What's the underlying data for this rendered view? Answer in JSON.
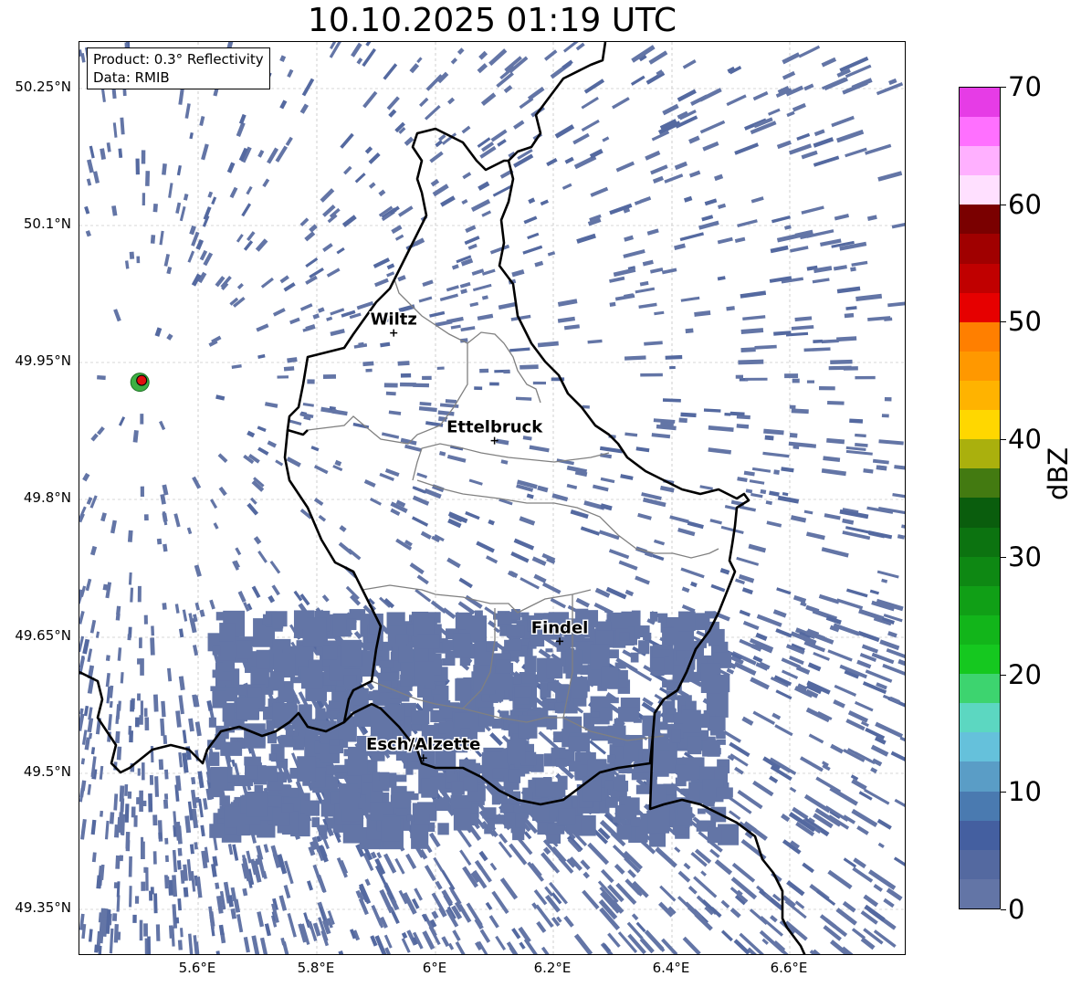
{
  "title": "10.10.2025 01:19 UTC",
  "product_box": {
    "product": "Product: 0.3° Reflectivity",
    "data": "Data: RMIB"
  },
  "lat_labels": [
    "50.25°N",
    "50.1°N",
    "49.95°N",
    "49.8°N",
    "49.65°N",
    "49.5°N",
    "49.35°N"
  ],
  "lon_labels": [
    "5.6°E",
    "5.8°E",
    "6°E",
    "6.2°E",
    "6.4°E",
    "6.6°E"
  ],
  "cities": [
    {
      "name": "Wiltz",
      "lon": 5.93,
      "lat": 49.966
    },
    {
      "name": "Ettelbruck",
      "lon": 6.1,
      "lat": 49.848
    },
    {
      "name": "Findel",
      "lon": 6.21,
      "lat": 49.628
    },
    {
      "name": "Esch/Alzette",
      "lon": 5.98,
      "lat": 49.5
    }
  ],
  "radar_site": {
    "lon": 5.505,
    "lat": 49.914
  },
  "colorbar": {
    "unit": "dBZ",
    "ticks": [
      "0",
      "10",
      "20",
      "30",
      "40",
      "50",
      "60",
      "70"
    ],
    "colors": [
      "#6375a6",
      "#5469a0",
      "#445fa0",
      "#4a7ab0",
      "#5a9dc6",
      "#65c1db",
      "#5cd7c1",
      "#3dd46f",
      "#15c81f",
      "#12b51a",
      "#109f16",
      "#0e8813",
      "#0c7310",
      "#0a5d0d",
      "#437a11",
      "#aab00d",
      "#ffd700",
      "#ffb300",
      "#ff9800",
      "#ff7f00",
      "#e60000",
      "#c00000",
      "#a00000",
      "#7a0000",
      "#ffe0ff",
      "#ffb0ff",
      "#ff70ff",
      "#e63ce6"
    ]
  },
  "map_extent": {
    "lon_min": 5.4,
    "lon_max": 6.795,
    "lat_min": 49.283,
    "lat_max": 50.285
  }
}
